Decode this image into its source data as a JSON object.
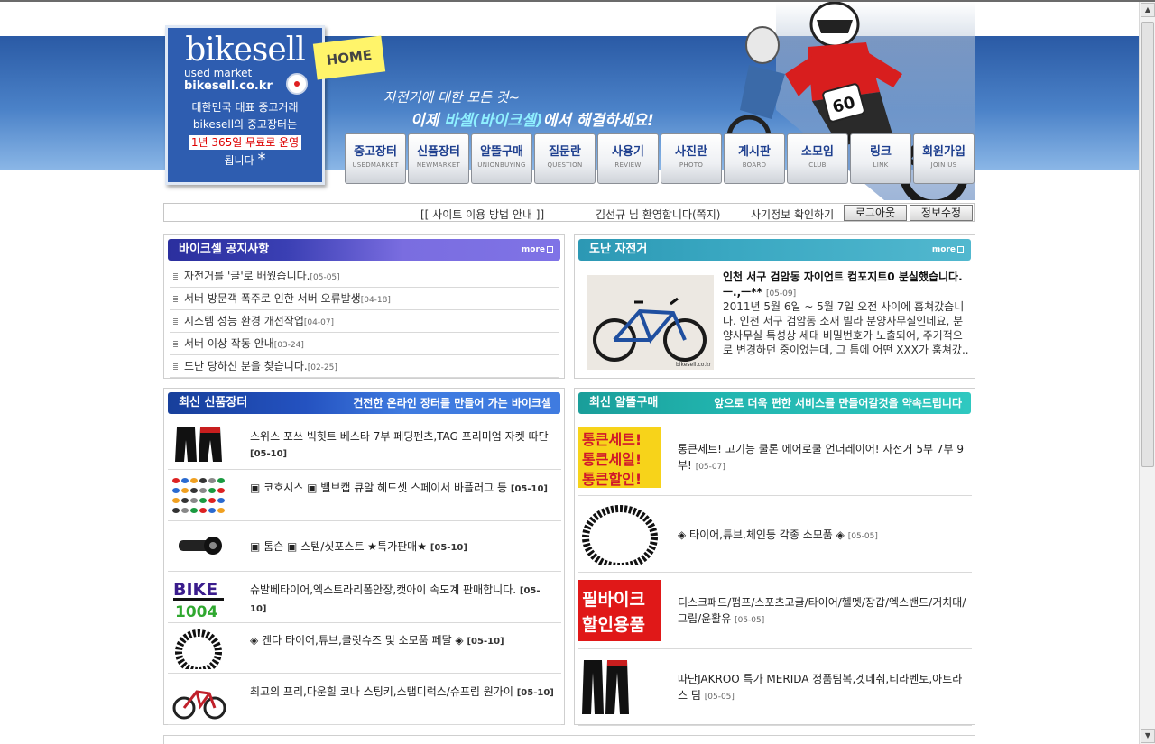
{
  "logo": {
    "name": "bikesell",
    "sub1": "used market",
    "sub2": "bikesell.co.kr",
    "line1": "대한민국 대표 중고거래",
    "line2": "bikesell의 중고장터는",
    "highlight": "1년 365일 무료로 운영",
    "line3": "됩니다",
    "star": "*"
  },
  "home_tag": "HOME",
  "slogan": {
    "line1": "자전거에 대한 모든 것~",
    "line2_pre": "이제 ",
    "line2_hl": "바셀(바이크셀)",
    "line2_post": "에서 해결하세요!"
  },
  "rider_number": "60",
  "nav": [
    {
      "ko": "중고장터",
      "en": "USEDMARKET"
    },
    {
      "ko": "신품장터",
      "en": "NEWMARKET"
    },
    {
      "ko": "알뜰구매",
      "en": "UNIONBUYING"
    },
    {
      "ko": "질문란",
      "en": "QUESTION"
    },
    {
      "ko": "사용기",
      "en": "REVIEW"
    },
    {
      "ko": "사진란",
      "en": "PHOTO"
    },
    {
      "ko": "게시판",
      "en": "BOARD"
    },
    {
      "ko": "소모임",
      "en": "CLUB"
    },
    {
      "ko": "링크",
      "en": "LINK"
    },
    {
      "ko": "회원가입",
      "en": "JOIN US"
    }
  ],
  "infobar": {
    "guide": "[[ 사이트 이용 방법 안내 ]]",
    "welcome": "김선규 님 환영합니다(쪽지)",
    "fraud": "사기정보 확인하기",
    "logout": "로그아웃",
    "edit": "정보수정"
  },
  "notice": {
    "title": "바이크셀 공지사항",
    "more": "more",
    "items": [
      {
        "text": "자전거를 '글'로 배웠습니다.",
        "date": "[05-05]"
      },
      {
        "text": "서버 방문객 폭주로 인한 서버 오류발생",
        "date": "[04-18]"
      },
      {
        "text": "시스템 성능 환경 개선작업",
        "date": "[04-07]"
      },
      {
        "text": "서버 이상 작동 안내",
        "date": "[03-24]"
      },
      {
        "text": "도난 당하신 분을 찾습니다.",
        "date": "[02-25]"
      }
    ]
  },
  "theft": {
    "title": "도난 자전거",
    "more": "more",
    "post_title": "인천 서구 검암동 자이언트 컴포지트0 분실했습니다. ㅡ.,ㅡ**",
    "post_date": "[05-09]",
    "body": "2011년 5월 6일 ~ 5월 7일 오전 사이에 훔쳐갔습니다. 인천 서구 검암동 소재 빌라 분양사무실인데요, 분양사무실 특성상 세대 비밀번호가 노출되어, 주기적으로 변경하던 중이었는데, 그 틈에 어떤 XXX가 훔쳐갔..",
    "watermark": "bikesell.co.kr"
  },
  "newmarket": {
    "title": "최신 신품장터",
    "tagline": "건전한 온라인 장터를 만들어 가는 바이크셀",
    "items": [
      {
        "text": "스위스 포쓰 빅힛트 베스타 7부 페딩펜츠,TAG 프리미엄 자켓 따단",
        "date": "[05-10]",
        "icon": "cycling-shorts-thumb"
      },
      {
        "text": "▣ 코호시스 ▣ 밸브캡 큐알 헤드셋 스페이서 바플러그 등",
        "date": "[05-10]",
        "icon": "parts-assortment-thumb"
      },
      {
        "text": "▣ 톰슨 ▣ 스템/싯포스트 ★특가판매★",
        "date": "[05-10]",
        "icon": "stem-thumb"
      },
      {
        "text": "슈발베타이어,엑스트라리폼안장,캣아이 속도계 판매합니다.",
        "date": "[05-10]",
        "icon": "bike1004-logo-thumb"
      },
      {
        "text": "◈ 켄다 타이어,튜브,클릿슈즈 및 소모품 페달 ◈",
        "date": "[05-10]",
        "icon": "tire-thumb"
      },
      {
        "text": "최고의 프리,다운힐 코나 스팅키,스탭디럭스/슈프림 원가이",
        "date": "[05-10]",
        "icon": "downhill-bike-thumb"
      }
    ],
    "bike1004_logo": "BIKE",
    "bike1004_num": "1004"
  },
  "buying": {
    "title": "최신 알뜰구매",
    "tagline": "앞으로 더욱 편한 서비스를 만들어갈것을 약속드립니다",
    "items": [
      {
        "text": "통큰세트! 고기능 쿨론 에어로쿨 언더레이어! 자전거 5부 7부 9부!",
        "date": "[05-07]",
        "icon": "sale-banner-thumb"
      },
      {
        "text": "◈ 타이어,튜브,체인등 각종 소모품 ◈",
        "date": "[05-05]",
        "icon": "tire-thumb"
      },
      {
        "text": "디스크패드/펌프/스포츠고글/타이어/헬멧/장갑/엑스밴드/거치대/그립/윤활유",
        "date": "[05-05]",
        "icon": "pil-bike-banner-thumb"
      },
      {
        "text": "따단JAKROO 특가 MERIDA 정품팀복,겟네춰,티라벤토,아트라스 팀",
        "date": "[05-05]",
        "icon": "cycling-shorts-thumb"
      }
    ],
    "sale_lines": [
      "통큰세트!",
      "통큰세일!",
      "통큰할인!"
    ],
    "pil_lines": [
      "필바이크",
      "할인용품"
    ]
  },
  "colors": {
    "band_top": "#2a5aa5",
    "band_bottom": "#8ab6e6",
    "nav_text": "#1e3f8f",
    "notice_header": "#3a3fb3",
    "theft_header": "#3aa8c2",
    "newmarket_header": "#2452c0",
    "buying_header": "#22b6b0"
  }
}
